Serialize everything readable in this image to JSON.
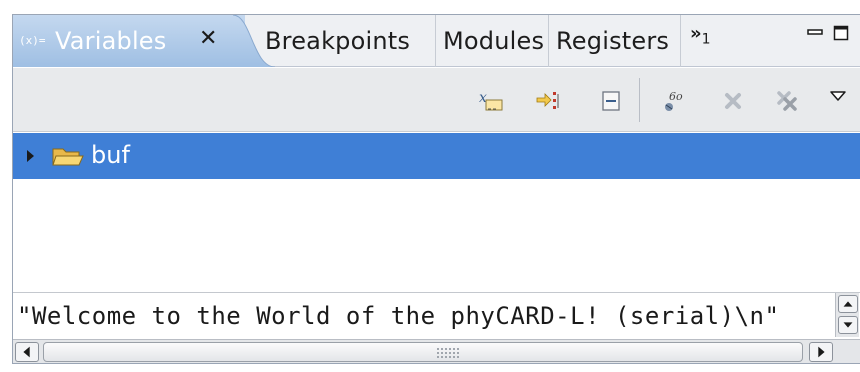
{
  "tabs": {
    "active_icon": "(x)=",
    "active_label": "Variables",
    "items": [
      "Breakpoints",
      "Modules",
      "Registers"
    ],
    "overflow_count": "1"
  },
  "toolbar": {
    "buttons": [
      "show-type-names-icon",
      "show-logical-structure-icon",
      "collapse-all-icon",
      "add-watch-expression-icon",
      "remove-selected-icon",
      "remove-all-icon",
      "view-menu-icon"
    ]
  },
  "tree": {
    "rows": [
      {
        "label": "buf",
        "icon": "folder-open-icon",
        "selected": true
      }
    ]
  },
  "detail": {
    "value": "\"Welcome to the World of the phyCARD-L! (serial)\\n\""
  },
  "colors": {
    "selection": "#3f7fd6",
    "active_tab": "#a7c4e6"
  }
}
